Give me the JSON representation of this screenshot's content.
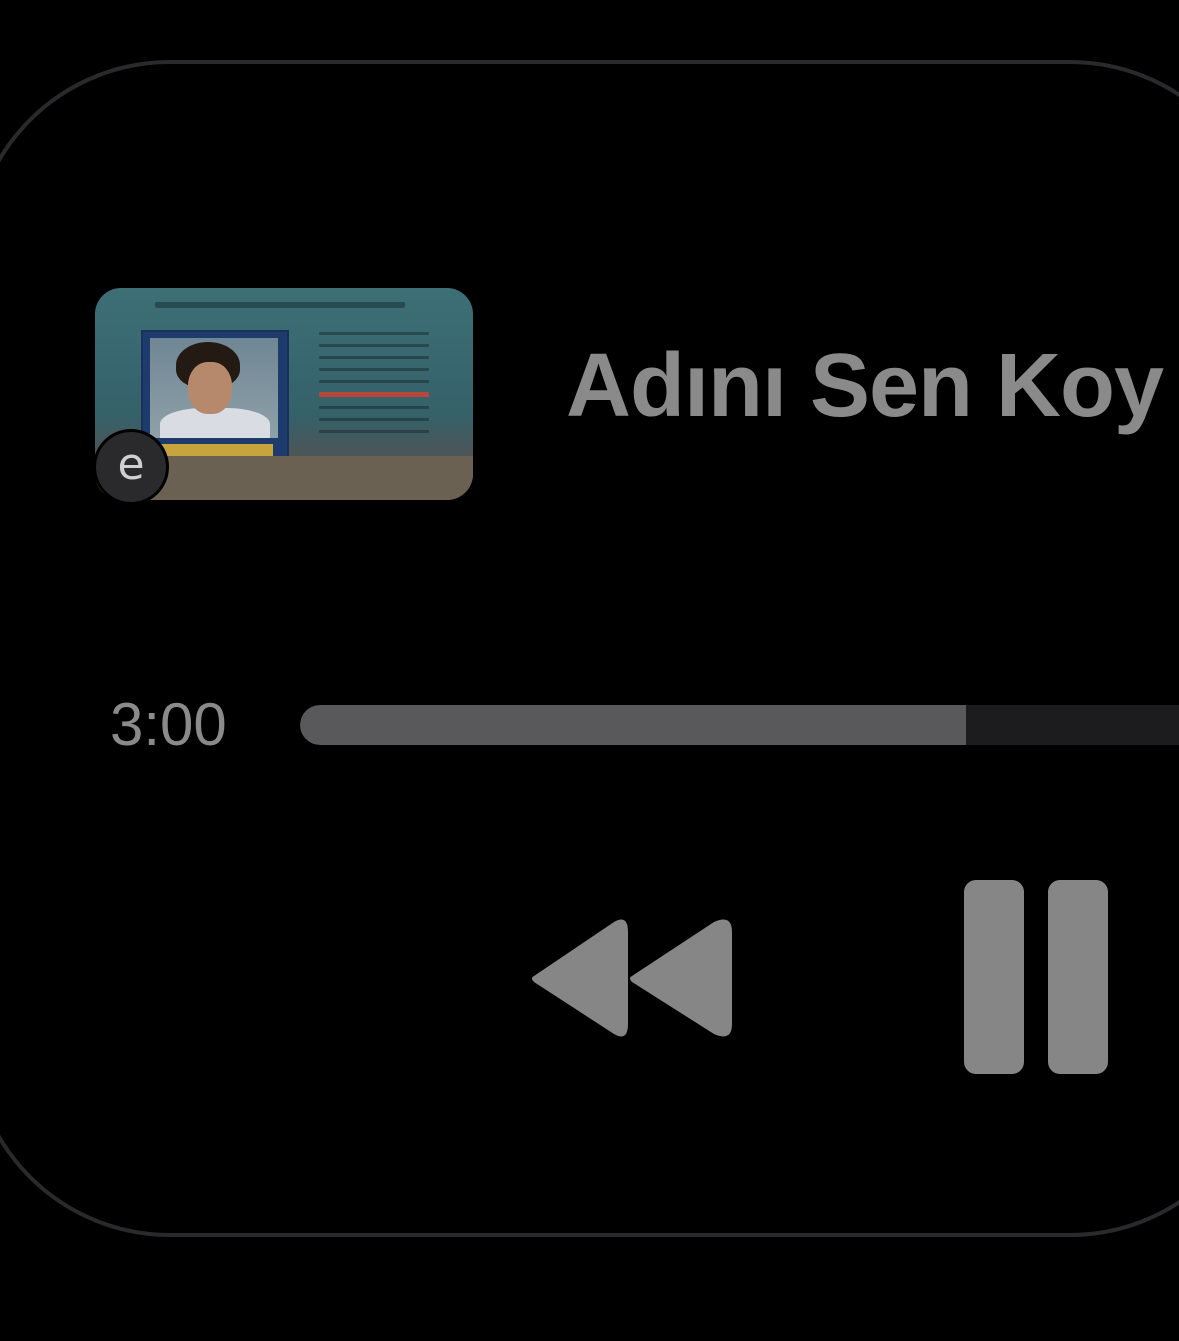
{
  "now_playing": {
    "title": "Adını Sen Koy",
    "artwork_badge": "e",
    "elapsed_time": "3:00",
    "progress": 0.74
  },
  "controls": {
    "rewind_icon": "rewind-icon",
    "pause_icon": "pause-icon"
  },
  "colors": {
    "background": "#000000",
    "card_border": "#2a2a2c",
    "text": "#8a8a8a",
    "progress_fill": "#59595c",
    "progress_track": "#1c1c1e",
    "controls": "#868686"
  }
}
